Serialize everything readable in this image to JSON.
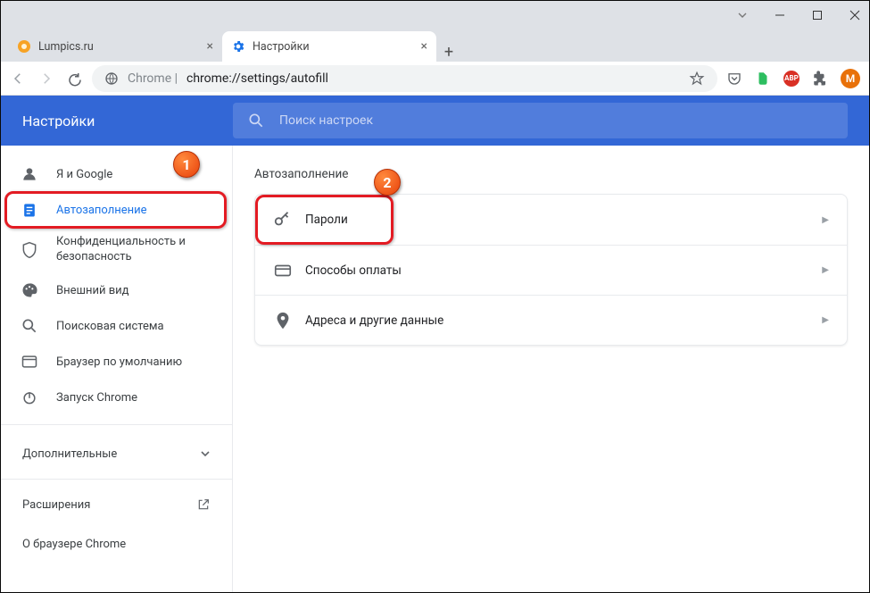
{
  "window": {
    "tabs": [
      {
        "title": "Lumpics.ru",
        "active": false
      },
      {
        "title": "Настройки",
        "active": true
      }
    ]
  },
  "address": {
    "scheme_host": "Chrome |",
    "path": "chrome://settings/autofill"
  },
  "avatar_letter": "M",
  "header": {
    "title": "Настройки",
    "search_placeholder": "Поиск настроек"
  },
  "sidebar": {
    "items": [
      {
        "label": "Я и Google"
      },
      {
        "label": "Автозаполнение"
      },
      {
        "label": "Конфиденциальность и безопасность"
      },
      {
        "label": "Внешний вид"
      },
      {
        "label": "Поисковая система"
      },
      {
        "label": "Браузер по умолчанию"
      },
      {
        "label": "Запуск Chrome"
      }
    ],
    "advanced": "Дополнительные",
    "links": {
      "extensions": "Расширения",
      "about": "О браузере Chrome"
    }
  },
  "main": {
    "section_title": "Автозаполнение",
    "rows": [
      {
        "label": "Пароли"
      },
      {
        "label": "Способы оплаты"
      },
      {
        "label": "Адреса и другие данные"
      }
    ]
  },
  "annotations": {
    "b1": "1",
    "b2": "2"
  }
}
